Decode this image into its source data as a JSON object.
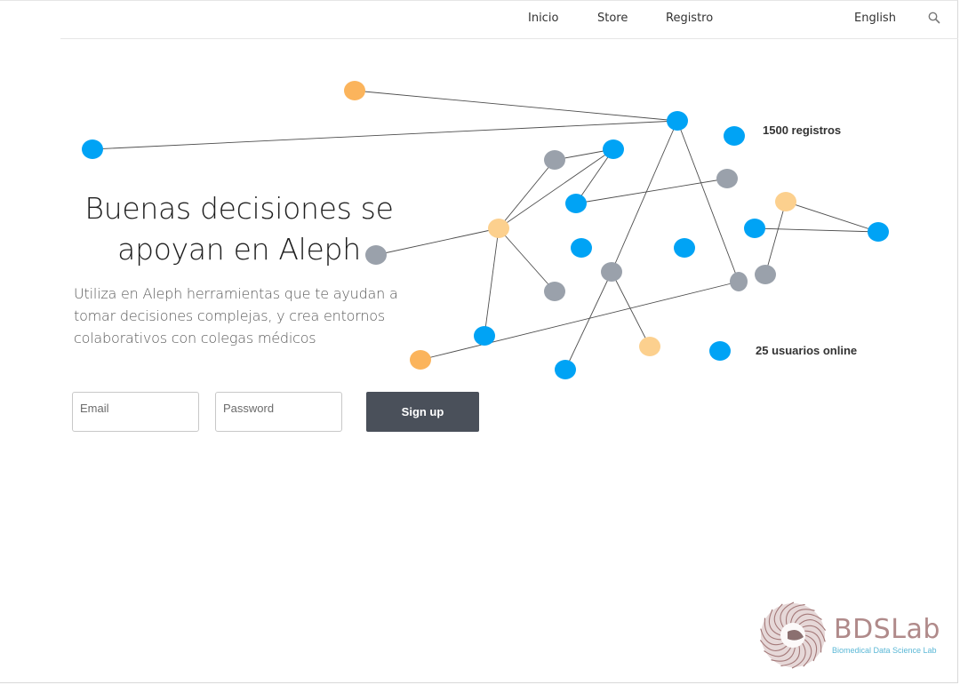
{
  "nav": {
    "items": [
      {
        "label": "Inicio"
      },
      {
        "label": "Store"
      },
      {
        "label": "Registro"
      }
    ],
    "language": "English",
    "search_icon": "search-icon"
  },
  "graph": {
    "stats": {
      "registros": "1500 registros",
      "usuarios": "25 usuarios online"
    },
    "node_colors": {
      "blue": "#00a3f5",
      "gray": "#9aa1ab",
      "orange": "#fbb45c",
      "peach": "#fcd08e"
    }
  },
  "hero": {
    "title": "Buenas decisiones se apoyan en Aleph",
    "subtitle": "Utiliza en Aleph herramientas que te ayudan a tomar decisiones complejas, y crea entornos colaborativos con colegas médicos"
  },
  "form": {
    "email_placeholder": "Email",
    "password_placeholder": "Password",
    "submit_label": "Sign up",
    "button_color": "#4a505a"
  },
  "logo": {
    "title": "BDSLab",
    "subtitle": "Biomedical Data Science Lab"
  }
}
